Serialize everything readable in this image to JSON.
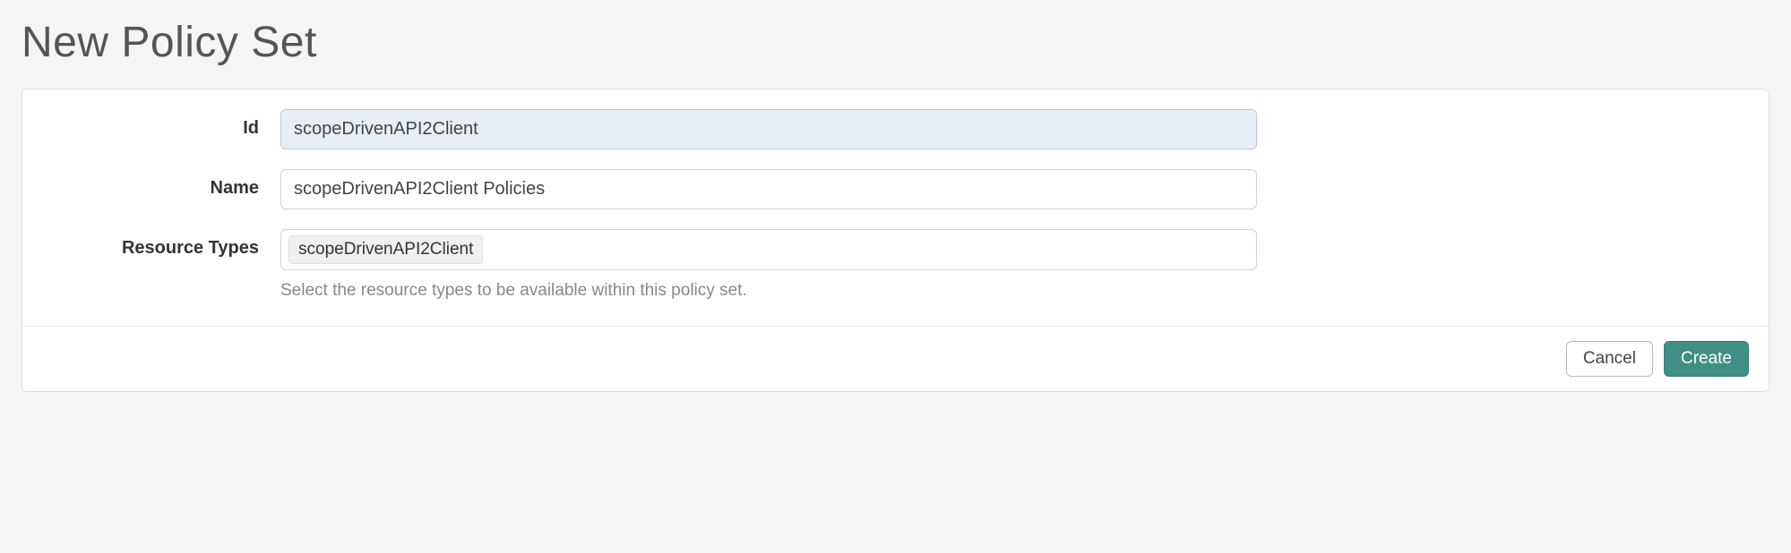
{
  "page": {
    "title": "New Policy Set"
  },
  "form": {
    "id": {
      "label": "Id",
      "value": "scopeDrivenAPI2Client"
    },
    "name": {
      "label": "Name",
      "value": "scopeDrivenAPI2Client Policies"
    },
    "resourceTypes": {
      "label": "Resource Types",
      "tokens": [
        "scopeDrivenAPI2Client"
      ],
      "helpText": "Select the resource types to be available within this policy set."
    }
  },
  "actions": {
    "cancel": "Cancel",
    "create": "Create"
  }
}
